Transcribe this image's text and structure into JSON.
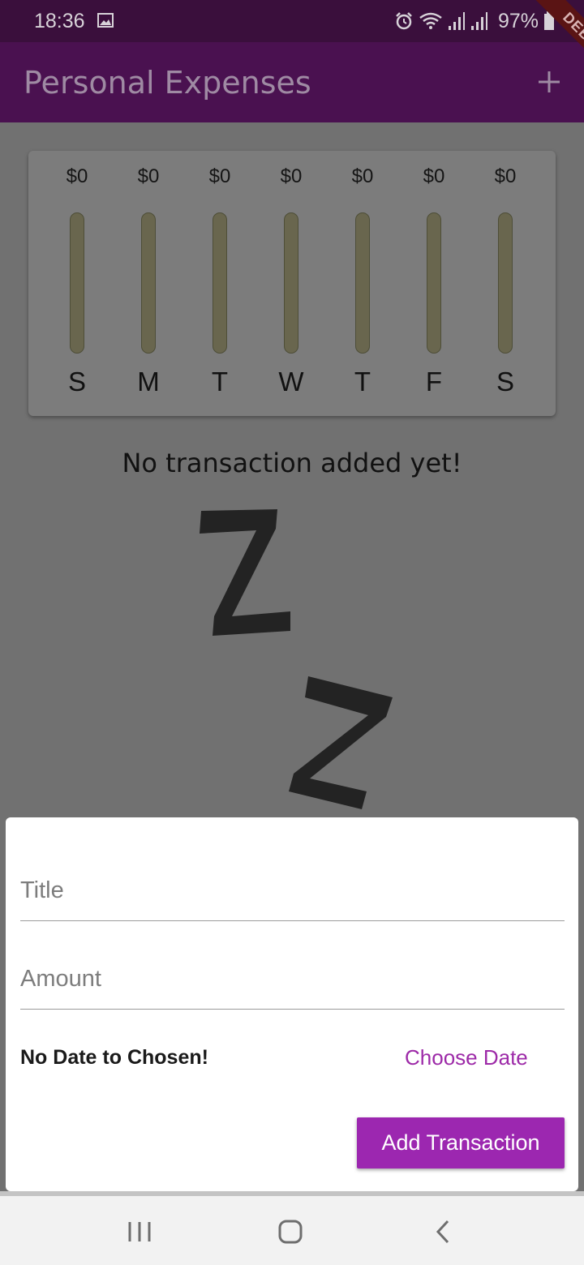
{
  "status_bar": {
    "time": "18:36",
    "battery_text": "97%",
    "icons": [
      "gallery-icon",
      "alarm-icon",
      "wifi-icon",
      "signal-icon",
      "signal-icon",
      "battery-icon"
    ]
  },
  "app_bar": {
    "title": "Personal Expenses",
    "action_icon": "add-icon",
    "debug_banner": "DEBUG"
  },
  "chart": {
    "bar_color": "#69664e",
    "fill_color": "#5a1a5e",
    "bars": [
      {
        "day": "S",
        "amount": "$0",
        "fill": 0
      },
      {
        "day": "M",
        "amount": "$0",
        "fill": 0
      },
      {
        "day": "T",
        "amount": "$0",
        "fill": 0
      },
      {
        "day": "W",
        "amount": "$0",
        "fill": 0
      },
      {
        "day": "T",
        "amount": "$0",
        "fill": 0
      },
      {
        "day": "F",
        "amount": "$0",
        "fill": 0
      },
      {
        "day": "S",
        "amount": "$0",
        "fill": 0
      }
    ]
  },
  "empty_state": {
    "message": "No transaction added yet!",
    "image_icon": "sleeping-zz-icon"
  },
  "form": {
    "title_placeholder": "Title",
    "title_value": "",
    "amount_placeholder": "Amount",
    "amount_value": "",
    "date_text": "No Date to Chosen!",
    "choose_date_label": "Choose Date",
    "submit_label": "Add Transaction",
    "accent_color": "#9c27b0"
  },
  "nav_bar": {
    "buttons": [
      "recent-apps-icon",
      "home-icon",
      "back-icon"
    ]
  }
}
